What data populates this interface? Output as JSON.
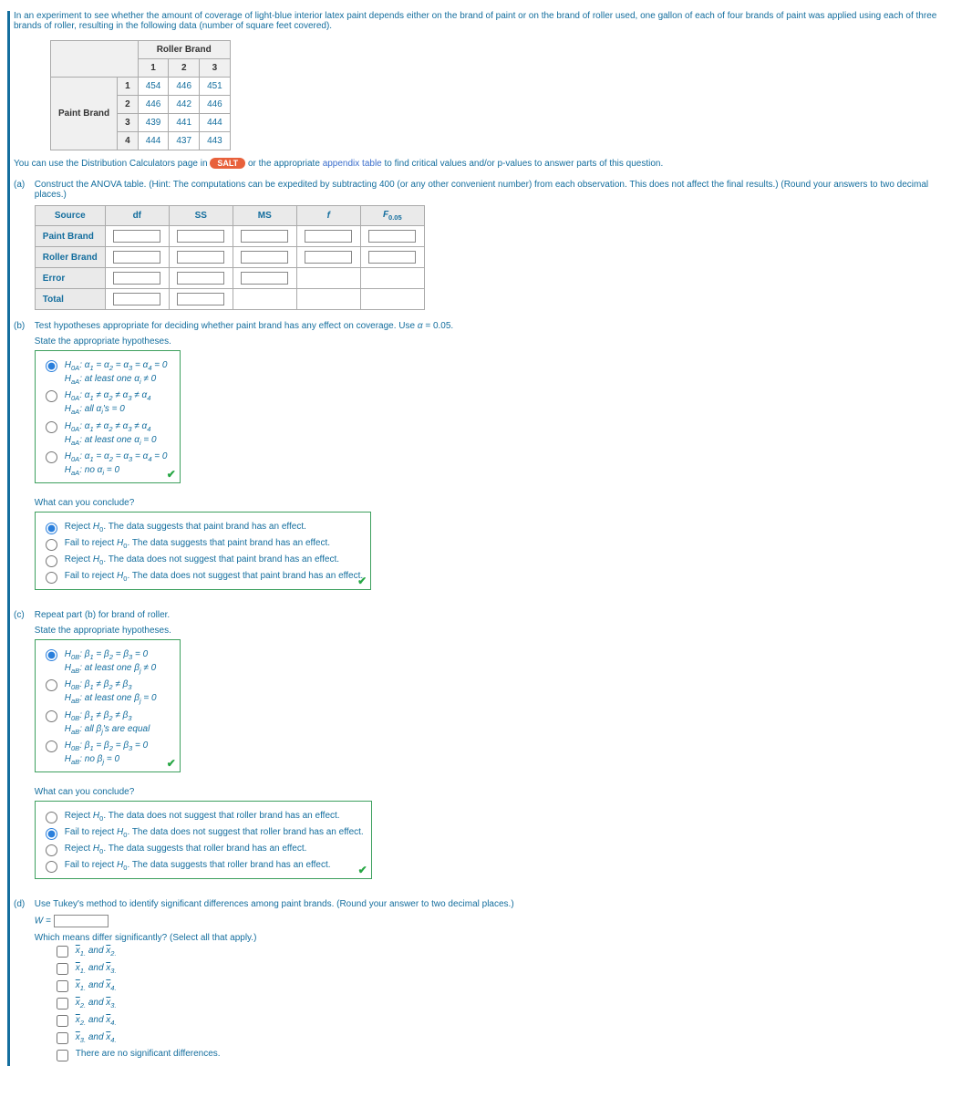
{
  "intro": "In an experiment to see whether the amount of coverage of light-blue interior latex paint depends either on the brand of paint or on the brand of roller used, one gallon of each of four brands of paint was applied using each of three brands of roller, resulting in the following data (number of square feet covered).",
  "dataTable": {
    "rollerHeader": "Roller Brand",
    "paintHeader": "Paint Brand",
    "cols": [
      "1",
      "2",
      "3"
    ],
    "rows": [
      {
        "label": "1",
        "cells": [
          "454",
          "446",
          "451"
        ]
      },
      {
        "label": "2",
        "cells": [
          "446",
          "442",
          "446"
        ]
      },
      {
        "label": "3",
        "cells": [
          "439",
          "441",
          "444"
        ]
      },
      {
        "label": "4",
        "cells": [
          "444",
          "437",
          "443"
        ]
      }
    ]
  },
  "usage_pre": "You can use the Distribution Calculators page in",
  "salt": "SALT",
  "usage_mid": "or the appropriate",
  "appendix": "appendix table",
  "usage_post": "to find critical values and/or p-values to answer parts of this question.",
  "partA": {
    "label": "(a)",
    "text": "Construct the ANOVA table. (Hint: The computations can be expedited by subtracting 400 (or any other convenient number) from each observation. This does not affect the final results.) (Round your answers to two decimal places.)",
    "headers": [
      "Source",
      "df",
      "SS",
      "MS",
      "f",
      "F0.05"
    ],
    "rows": [
      "Paint Brand",
      "Roller Brand",
      "Error",
      "Total"
    ],
    "chart_data": {
      "type": "table",
      "columns": [
        "Source",
        "df",
        "SS",
        "MS",
        "f",
        "F0.05"
      ],
      "rows": [
        {
          "Source": "Paint Brand",
          "df": "",
          "SS": "",
          "MS": "",
          "f": "",
          "F0.05": ""
        },
        {
          "Source": "Roller Brand",
          "df": "",
          "SS": "",
          "MS": "",
          "f": "",
          "F0.05": ""
        },
        {
          "Source": "Error",
          "df": "",
          "SS": "",
          "MS": "",
          "f": null,
          "F0.05": null
        },
        {
          "Source": "Total",
          "df": "",
          "SS": "",
          "MS": null,
          "f": null,
          "F0.05": null
        }
      ]
    }
  },
  "partB": {
    "label": "(b)",
    "text": "Test hypotheses appropriate for deciding whether paint brand has any effect on coverage. Use α = 0.05.",
    "stateHyp": "State the appropriate hypotheses.",
    "opts": [
      "H0A: α1 = α2 = α3 = α4 = 0\nHaA: at least one αi ≠ 0",
      "H0A: α1 ≠ α2 ≠ α3 ≠ α4\nHaA: all αi's = 0",
      "H0A: α1 ≠ α2 ≠ α3 ≠ α4\nHaA: at least one αi = 0",
      "H0A: α1 = α2 = α3 = α4 = 0\nHaA: no αi = 0"
    ],
    "selected": 0,
    "conclQ": "What can you conclude?",
    "concl": [
      "Reject H0. The data suggests that paint brand has an effect.",
      "Fail to reject H0. The data suggests that paint brand has an effect.",
      "Reject H0. The data does not suggest that paint brand has an effect.",
      "Fail to reject H0. The data does not suggest that paint brand has an effect."
    ],
    "conclSelected": 0
  },
  "partC": {
    "label": "(c)",
    "text": "Repeat part (b) for brand of roller.",
    "stateHyp": "State the appropriate hypotheses.",
    "opts": [
      "H0B: β1 = β2 = β3 = 0\nHaB: at least one βj ≠ 0",
      "H0B: β1 ≠ β2 ≠ β3\nHaB: at least one βj = 0",
      "H0B: β1 ≠ β2 ≠ β3\nHaB: all βj's are equal",
      "H0B: β1 = β2 = β3 = 0\nHaB: no βj = 0"
    ],
    "selected": 0,
    "conclQ": "What can you conclude?",
    "concl": [
      "Reject H0. The data does not suggest that roller brand has an effect.",
      "Fail to reject H0. The data does not suggest that roller brand has an effect.",
      "Reject H0. The data suggests that roller brand has an effect.",
      "Fail to reject H0. The data suggests that roller brand has an effect."
    ],
    "conclSelected": 1
  },
  "partD": {
    "label": "(d)",
    "text": "Use Tukey's method to identify significant differences among paint brands. (Round your answer to two decimal places.)",
    "wlabel": "W =",
    "whichQ": "Which means differ significantly? (Select all that apply.)",
    "pairs": [
      "x̄1. and x̄2.",
      "x̄1. and x̄3.",
      "x̄1. and x̄4.",
      "x̄2. and x̄3.",
      "x̄2. and x̄4.",
      "x̄3. and x̄4.",
      "There are no significant differences."
    ]
  }
}
